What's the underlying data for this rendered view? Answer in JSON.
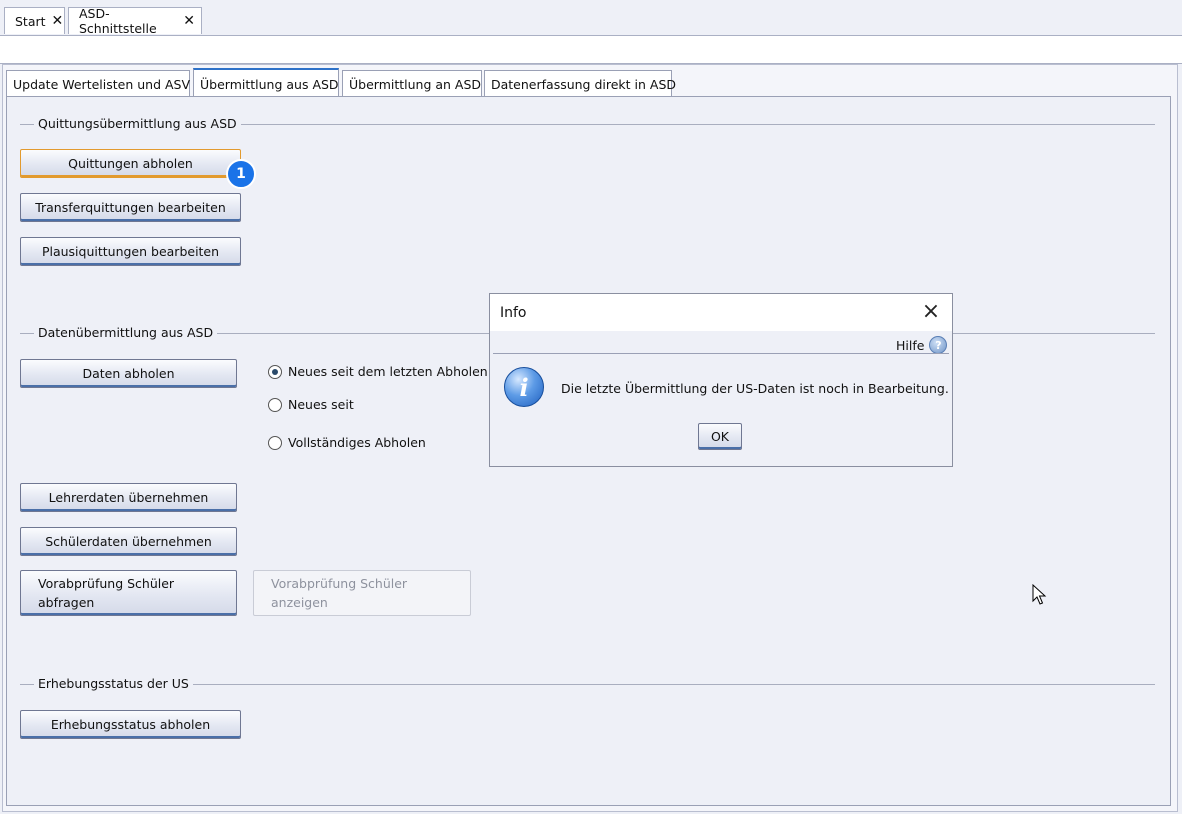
{
  "doc_tabs": [
    {
      "label": "Start"
    },
    {
      "label": "ASD-Schnittstelle"
    }
  ],
  "inner_tabs": [
    {
      "label": "Update Wertelisten und ASV"
    },
    {
      "label": "Übermittlung aus ASD",
      "active": true
    },
    {
      "label": "Übermittlung an ASD"
    },
    {
      "label": "Datenerfassung direkt in ASD"
    }
  ],
  "sections": {
    "quittung": {
      "title": "Quittungsübermittlung aus ASD",
      "buttons": [
        "Quittungen abholen",
        "Transferquittungen bearbeiten",
        "Plausiquittungen bearbeiten"
      ],
      "badge": "1"
    },
    "daten": {
      "title": "Datenübermittlung aus ASD",
      "fetch_button": "Daten abholen",
      "radios": [
        {
          "label": "Neues seit dem letzten Abholen a",
          "checked": true
        },
        {
          "label": "Neues seit",
          "checked": false
        },
        {
          "label": "Vollständiges Abholen",
          "checked": false
        }
      ],
      "buttons": [
        "Lehrerdaten übernehmen",
        "Schülerdaten übernehmen"
      ],
      "vorab_query": "Vorabprüfung Schüler abfragen",
      "vorab_query_lines": [
        "Vorabprüfung Schüler",
        "abfragen"
      ],
      "vorab_show_lines": [
        "Vorabprüfung Schüler",
        "anzeigen"
      ]
    },
    "erhebung": {
      "title": "Erhebungsstatus der US",
      "button": "Erhebungsstatus abholen"
    }
  },
  "dialog": {
    "title": "Info",
    "help_label": "Hilfe",
    "message": "Die letzte Übermittlung der US-Daten ist noch in Bearbeitung.",
    "ok_label": "OK"
  },
  "colors": {
    "accent": "#2e72c9",
    "badge": "#1a73e8",
    "focus": "#e29a2e"
  }
}
